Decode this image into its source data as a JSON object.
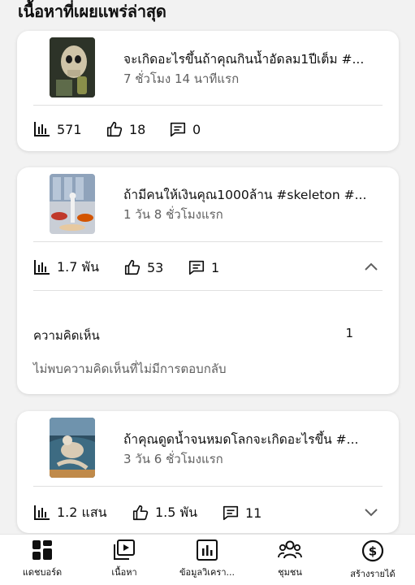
{
  "section_title": "เนื้อหาที่เผยแพร่ล่าสุด",
  "videos": [
    {
      "title": "จะเกิดอะไรขึ้นถ้าคุณกินน้ำอัดลม1ปีเต็ม #...",
      "time": "7 ชั่วโมง 14 นาทีแรก",
      "views": "571",
      "likes": "18",
      "comments": "0"
    },
    {
      "title": "ถ้ามีคนให้เงินคุณ1000ล้าน #skeleton #...",
      "time": "1 วัน 8 ชั่วโมงแรก",
      "views": "1.7 พัน",
      "likes": "53",
      "comments": "1",
      "expanded": {
        "comments_label": "ความคิดเห็น",
        "comments_count": "1",
        "no_reply_text": "ไม่พบความคิดเห็นที่ไม่มีการตอบกลับ"
      }
    },
    {
      "title": "ถ้าคุณดูดน้ำจนหมดโลกจะเกิดอะไรขึ้น #...",
      "time": "3 วัน 6 ชั่วโมงแรก",
      "views": "1.2 แสน",
      "likes": "1.5 พัน",
      "comments": "11"
    }
  ],
  "bottom_nav": [
    {
      "label": "แดชบอร์ด",
      "icon": "dashboard-icon",
      "active": true
    },
    {
      "label": "เนื้อหา",
      "icon": "content-icon"
    },
    {
      "label": "ข้อมูลวิเครา...",
      "icon": "analytics-icon"
    },
    {
      "label": "ชุมชน",
      "icon": "community-icon"
    },
    {
      "label": "สร้างรายได้",
      "icon": "earn-icon"
    }
  ]
}
